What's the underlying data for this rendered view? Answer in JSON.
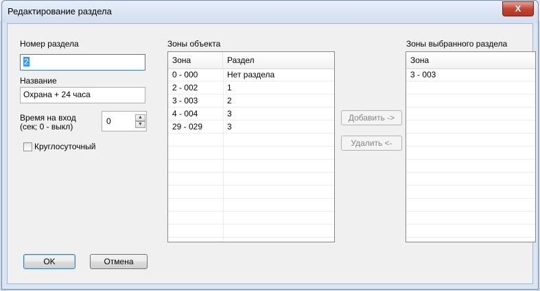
{
  "window": {
    "title": "Редактирование раздела",
    "close_symbol": "X"
  },
  "partition_number": {
    "label": "Номер раздела",
    "value": "2"
  },
  "name": {
    "label": "Название",
    "value": "Охрана + 24 часа"
  },
  "entry_time": {
    "label_line1": "Время на вход",
    "label_line2": "(сек; 0 - выкл)",
    "value": "0"
  },
  "round_the_clock": {
    "label": "Круглосуточный",
    "checked": false
  },
  "object_zones": {
    "title": "Зоны объекта",
    "columns": [
      "Зона",
      "Раздел"
    ],
    "rows": [
      [
        "0 - 000",
        "Нет раздела"
      ],
      [
        "2 - 002",
        "1"
      ],
      [
        "3 - 003",
        "2"
      ],
      [
        "4 - 004",
        "3"
      ],
      [
        "29 - 029",
        "3"
      ]
    ]
  },
  "actions": {
    "add_label": "Добавить ->",
    "remove_label": "Удалить <-"
  },
  "selected_zones": {
    "title": "Зоны выбранного раздела",
    "columns": [
      "Зона"
    ],
    "rows": [
      [
        "3 - 003"
      ]
    ]
  },
  "footer": {
    "ok_label": "OK",
    "cancel_label": "Отмена"
  }
}
